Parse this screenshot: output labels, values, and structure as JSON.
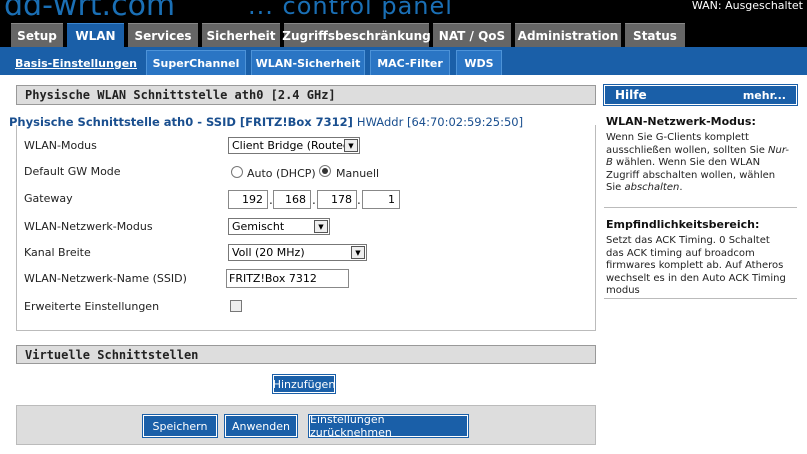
{
  "header": {
    "logo": "dd-wrt.com",
    "subtitle": "... control panel",
    "wan_status": "WAN: Ausgeschaltet"
  },
  "tabs": [
    "Setup",
    "WLAN",
    "Services",
    "Sicherheit",
    "Zugriffsbeschränkung",
    "NAT / QoS",
    "Administration",
    "Status"
  ],
  "active_tab": "WLAN",
  "subtabs": [
    "Basis-Einstellungen",
    "SuperChannel",
    "WLAN-Sicherheit",
    "MAC-Filter",
    "WDS"
  ],
  "active_subtab": "Basis-Einstellungen",
  "main": {
    "section_title": "Physische WLAN Schnittstelle ath0 [2.4 GHz]",
    "interface_prefix": "Physische Schnittstelle ath0 - SSID [FRITZ!Box 7312] ",
    "interface_hw": "HWAddr [64:70:02:59:25:50]",
    "fields": {
      "mode_label": "WLAN-Modus",
      "mode_value": "Client Bridge (Routed)",
      "gw_label": "Default GW Mode",
      "gw_auto": "Auto (DHCP)",
      "gw_manual": "Manuell",
      "gateway_label": "Gateway",
      "gateway": [
        "192",
        "168",
        "178",
        "1"
      ],
      "netmode_label": "WLAN-Netzwerk-Modus",
      "netmode_value": "Gemischt",
      "channel_width_label": "Kanal Breite",
      "channel_width_value": "Voll (20 MHz)",
      "ssid_label": "WLAN-Netzwerk-Name (SSID)",
      "ssid_value": "FRITZ!Box 7312",
      "advanced_label": "Erweiterte Einstellungen"
    },
    "virtual_title": "Virtuelle Schnittstellen",
    "add_button": "Hinzufügen",
    "buttons": {
      "save": "Speichern",
      "apply": "Anwenden",
      "reset": "Einstellungen zurücknehmen"
    }
  },
  "help": {
    "title": "Hilfe",
    "more": "mehr...",
    "s1_title": "WLAN-Netzwerk-Modus:",
    "s1_text_a": "Wenn Sie G-Clients komplett ausschließen wollen, sollten Sie ",
    "s1_text_b": "Nur-B",
    "s1_text_c": " wählen. Wenn Sie den WLAN Zugriff abschalten wollen, wählen Sie ",
    "s1_text_d": "abschalten",
    "s1_text_e": ".",
    "s2_title": "Empfindlichkeitsbereich:",
    "s2_text": "Setzt das ACK Timing. 0 Schaltet das ACK timing auf broadcom firmwares komplett ab. Auf Atheros wechselt es in den Auto ACK Timing modus"
  },
  "colors": {
    "accent": "#1a5fa8",
    "tab_inactive": "#666666",
    "section_bg": "#dddddd"
  }
}
